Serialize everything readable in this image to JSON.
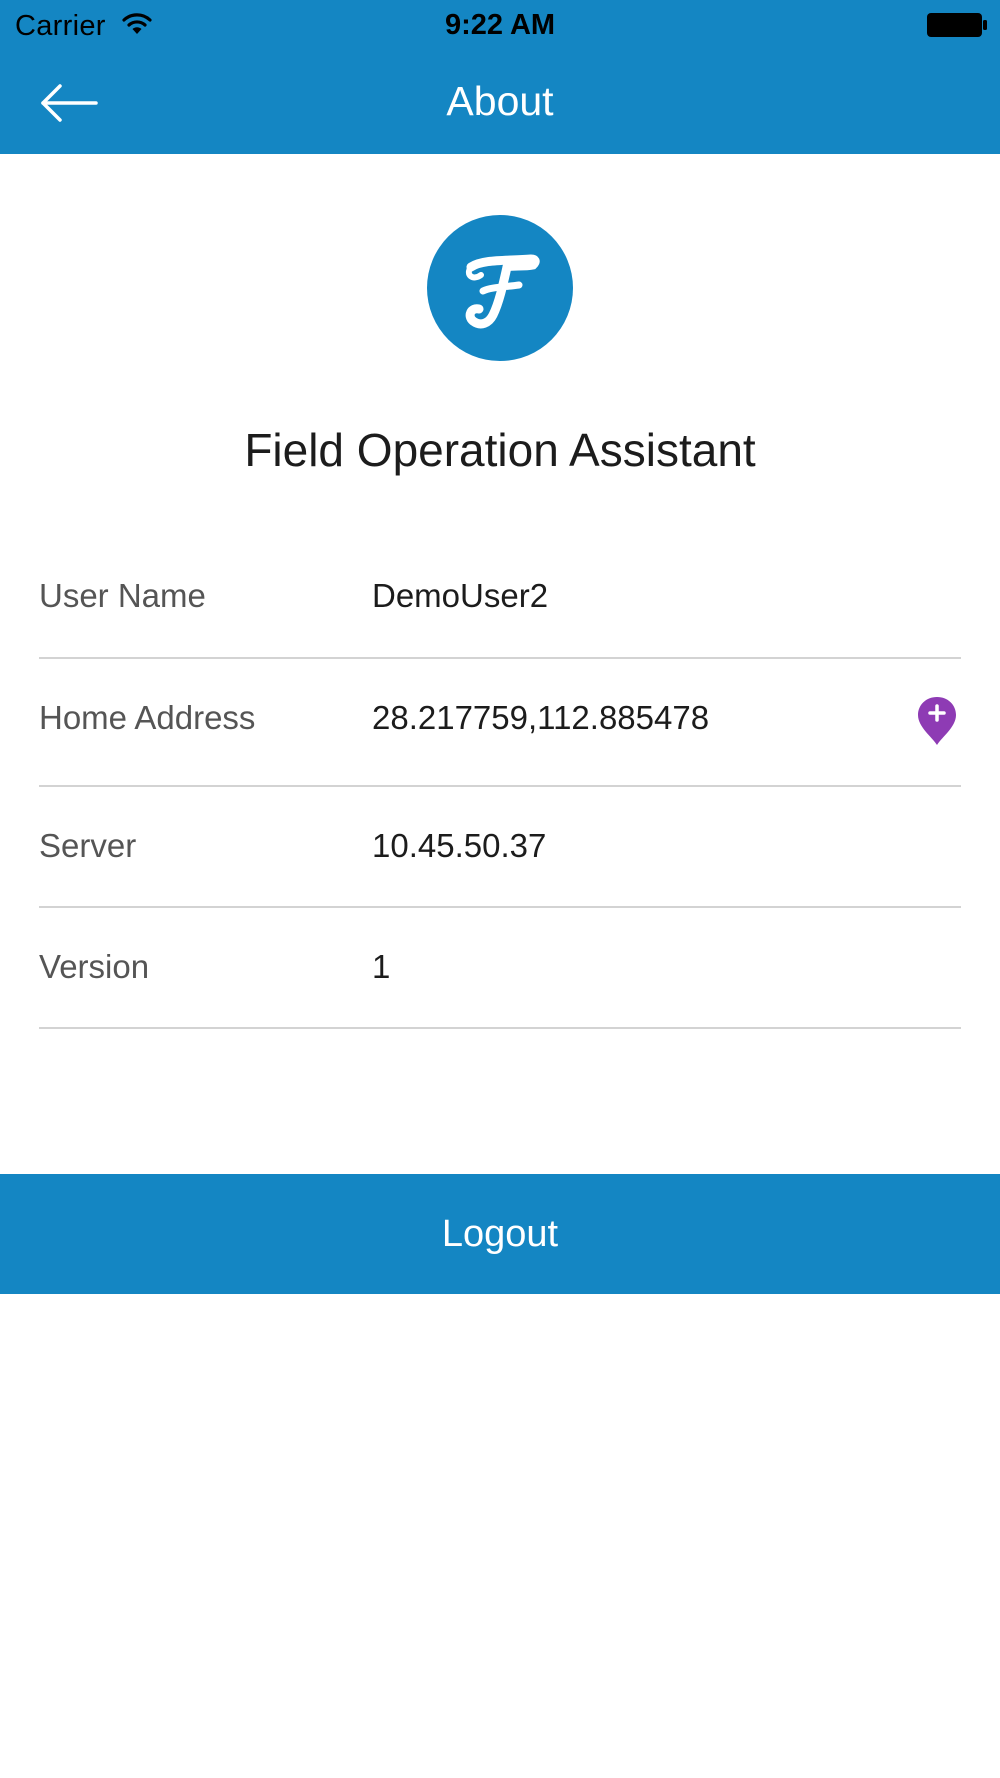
{
  "status_bar": {
    "carrier": "Carrier",
    "time": "9:22 AM",
    "wifi_icon": "wifi-icon",
    "battery_icon": "battery-full-icon"
  },
  "nav": {
    "back_icon": "arrow-left-icon",
    "title": "About"
  },
  "app": {
    "logo_icon": "app-logo-f",
    "name": "Field Operation Assistant"
  },
  "info_rows": [
    {
      "label": "User Name",
      "value": "DemoUser2"
    },
    {
      "label": "Home Address",
      "value": "28.217759,112.885478",
      "action_icon": "location-pin-add-icon"
    },
    {
      "label": "Server",
      "value": "10.45.50.37"
    },
    {
      "label": "Version",
      "value": "1"
    }
  ],
  "logout_label": "Logout",
  "colors": {
    "primary": "#1486c3",
    "pin": "#8e3bb4",
    "divider": "#d3d3d3",
    "label_text": "#555555",
    "value_text": "#1c1c1c"
  }
}
